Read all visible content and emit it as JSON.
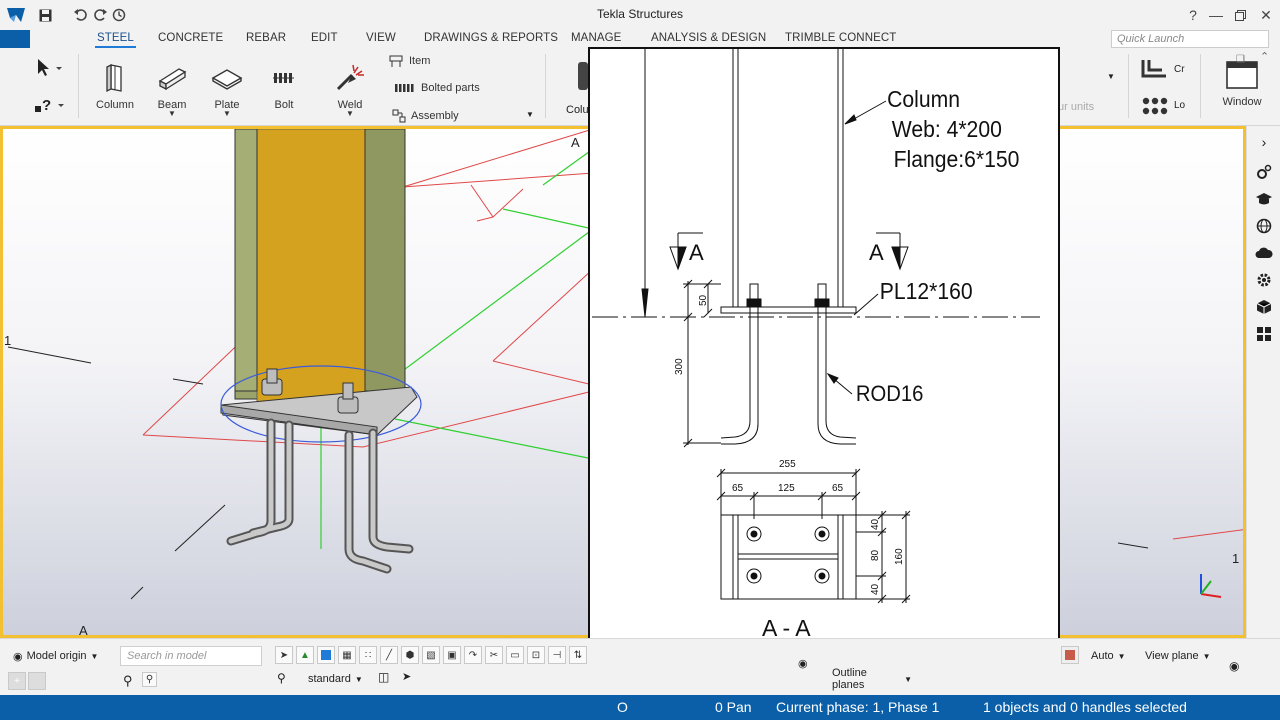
{
  "app": {
    "title": "Tekla Structures"
  },
  "menu": {
    "tabs": [
      "STEEL",
      "CONCRETE",
      "REBAR",
      "EDIT",
      "VIEW",
      "DRAWINGS & REPORTS",
      "MANAGE",
      "ANALYSIS & DESIGN",
      "TRIMBLE CONNECT"
    ],
    "active": "STEEL",
    "quick_launch_placeholder": "Quick Launch"
  },
  "ribbon": {
    "column": "Column",
    "beam": "Beam",
    "plate": "Plate",
    "bolt": "Bolt",
    "weld": "Weld",
    "item": "Item",
    "bolted_parts": "Bolted parts",
    "assembly": "Assembly",
    "truncated_colu": "Colu",
    "truncated_units": "ur units",
    "truncated_cr": "Cr",
    "truncated_lo": "Lo",
    "window": "Window"
  },
  "viewport": {
    "label_a_top": "A",
    "label_a_bottom": "A",
    "label_one_left": "1",
    "label_one_right": "1",
    "accent_border": "#f2c030",
    "column_color": "#9aa46a",
    "column_face_color": "#d4a21f"
  },
  "drawing": {
    "column_label": "Column",
    "web": "Web: 4*200",
    "flange": "Flange:6*150",
    "section_left": "A",
    "section_right": "A",
    "plate": "PL12*160",
    "rod": "ROD16",
    "dim_50": "50",
    "dim_300": "300",
    "dim_255": "255",
    "dim_65a": "65",
    "dim_125": "125",
    "dim_65b": "65",
    "dim_40a": "40",
    "dim_80": "80",
    "dim_40b": "40",
    "dim_160": "160",
    "section_title": "A - A"
  },
  "bottom": {
    "model_origin": "Model origin",
    "search_placeholder": "Search in model",
    "standard": "standard",
    "auto": "Auto",
    "view_plane": "View plane",
    "outline_planes": "Outline planes"
  },
  "status": {
    "o": "O",
    "pan": "0 Pan",
    "phase": "Current phase: 1, Phase 1",
    "selection": "1 objects and 0 handles selected"
  }
}
